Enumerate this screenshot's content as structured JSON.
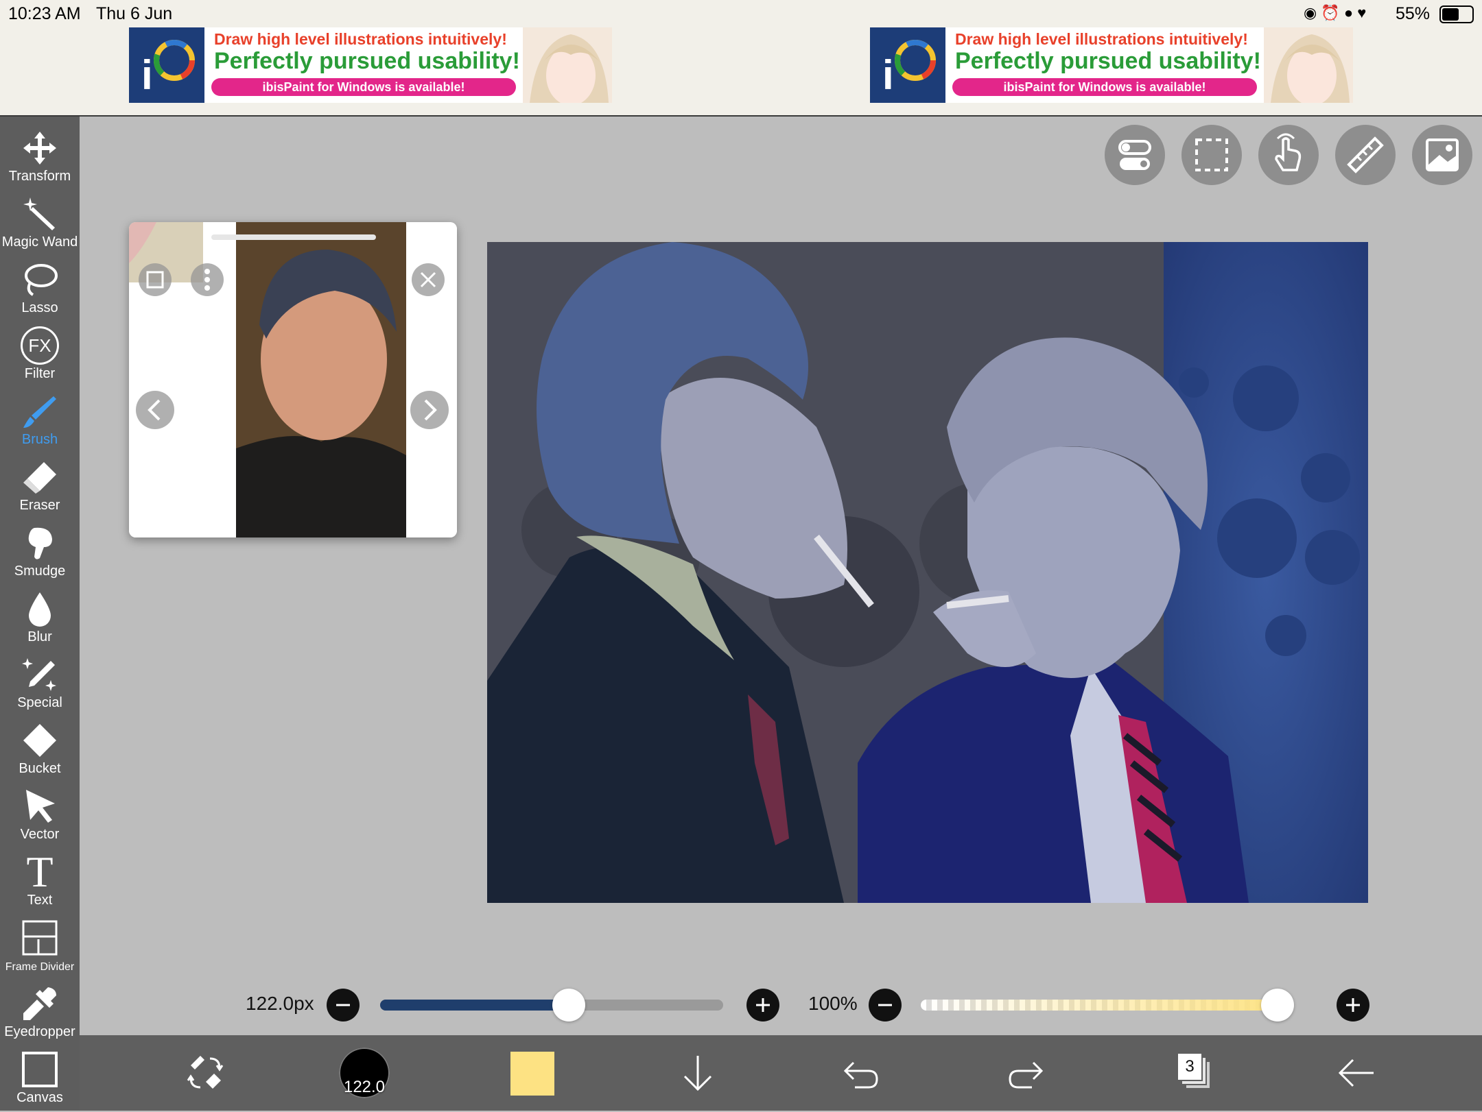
{
  "status_bar": {
    "time": "10:23 AM",
    "date": "Thu 6 Jun",
    "battery": "55%"
  },
  "ads": [
    {
      "line1": "Draw high level illustrations intuitively!",
      "line2": "Perfectly pursued usability!",
      "line3": "ibisPaint for Windows is available!"
    },
    {
      "line1": "Draw high level illustrations intuitively!",
      "line2": "Perfectly pursued usability!",
      "line3": "ibisPaint for Windows is available!"
    }
  ],
  "toolbar": {
    "active": "Brush",
    "active_color": "#3f9cf0",
    "tools": [
      "Transform",
      "Magic Wand",
      "Lasso",
      "Filter",
      "Brush",
      "Eraser",
      "Smudge",
      "Blur",
      "Special",
      "Bucket",
      "Vector",
      "Text",
      "Frame Divider",
      "Eyedropper",
      "Canvas"
    ],
    "filter_icon_text": "FX",
    "text_icon_glyph": "T"
  },
  "top_buttons": [
    "toggle-icon",
    "selection-icon",
    "touch-icon",
    "ruler-icon",
    "image-icon"
  ],
  "brush_size": {
    "label": "122.0px",
    "fraction": 0.55
  },
  "opacity": {
    "label": "100%",
    "fraction": 1.0
  },
  "bottom_bar": {
    "brush_preview_label": "122.0",
    "current_color": "#fde283",
    "layers_count": "3"
  }
}
